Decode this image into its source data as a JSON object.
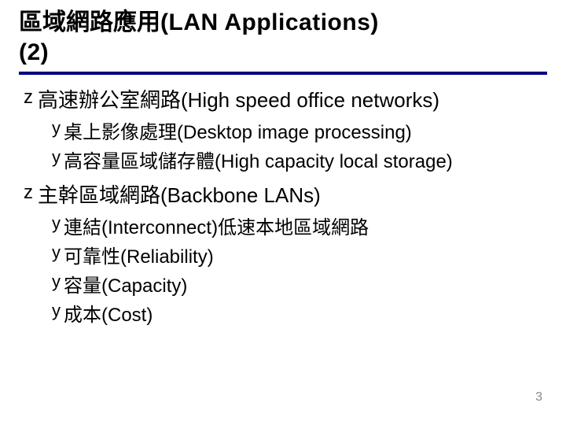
{
  "title_line1_zh": "區域網路應用",
  "title_line1_en": "(LAN Applications)",
  "title_line2": "(2)",
  "bullet_z": "z",
  "bullet_y": "y",
  "sections": [
    {
      "heading": "高速辦公室網路(High speed office networks)",
      "items": [
        "桌上影像處理(Desktop image processing)",
        "高容量區域儲存體(High capacity local storage)"
      ]
    },
    {
      "heading": "主幹區域網路(Backbone LANs)",
      "items": [
        "連結(Interconnect)低速本地區域網路",
        "可靠性(Reliability)",
        "容量(Capacity)",
        "成本(Cost)"
      ]
    }
  ],
  "page_number": "3"
}
